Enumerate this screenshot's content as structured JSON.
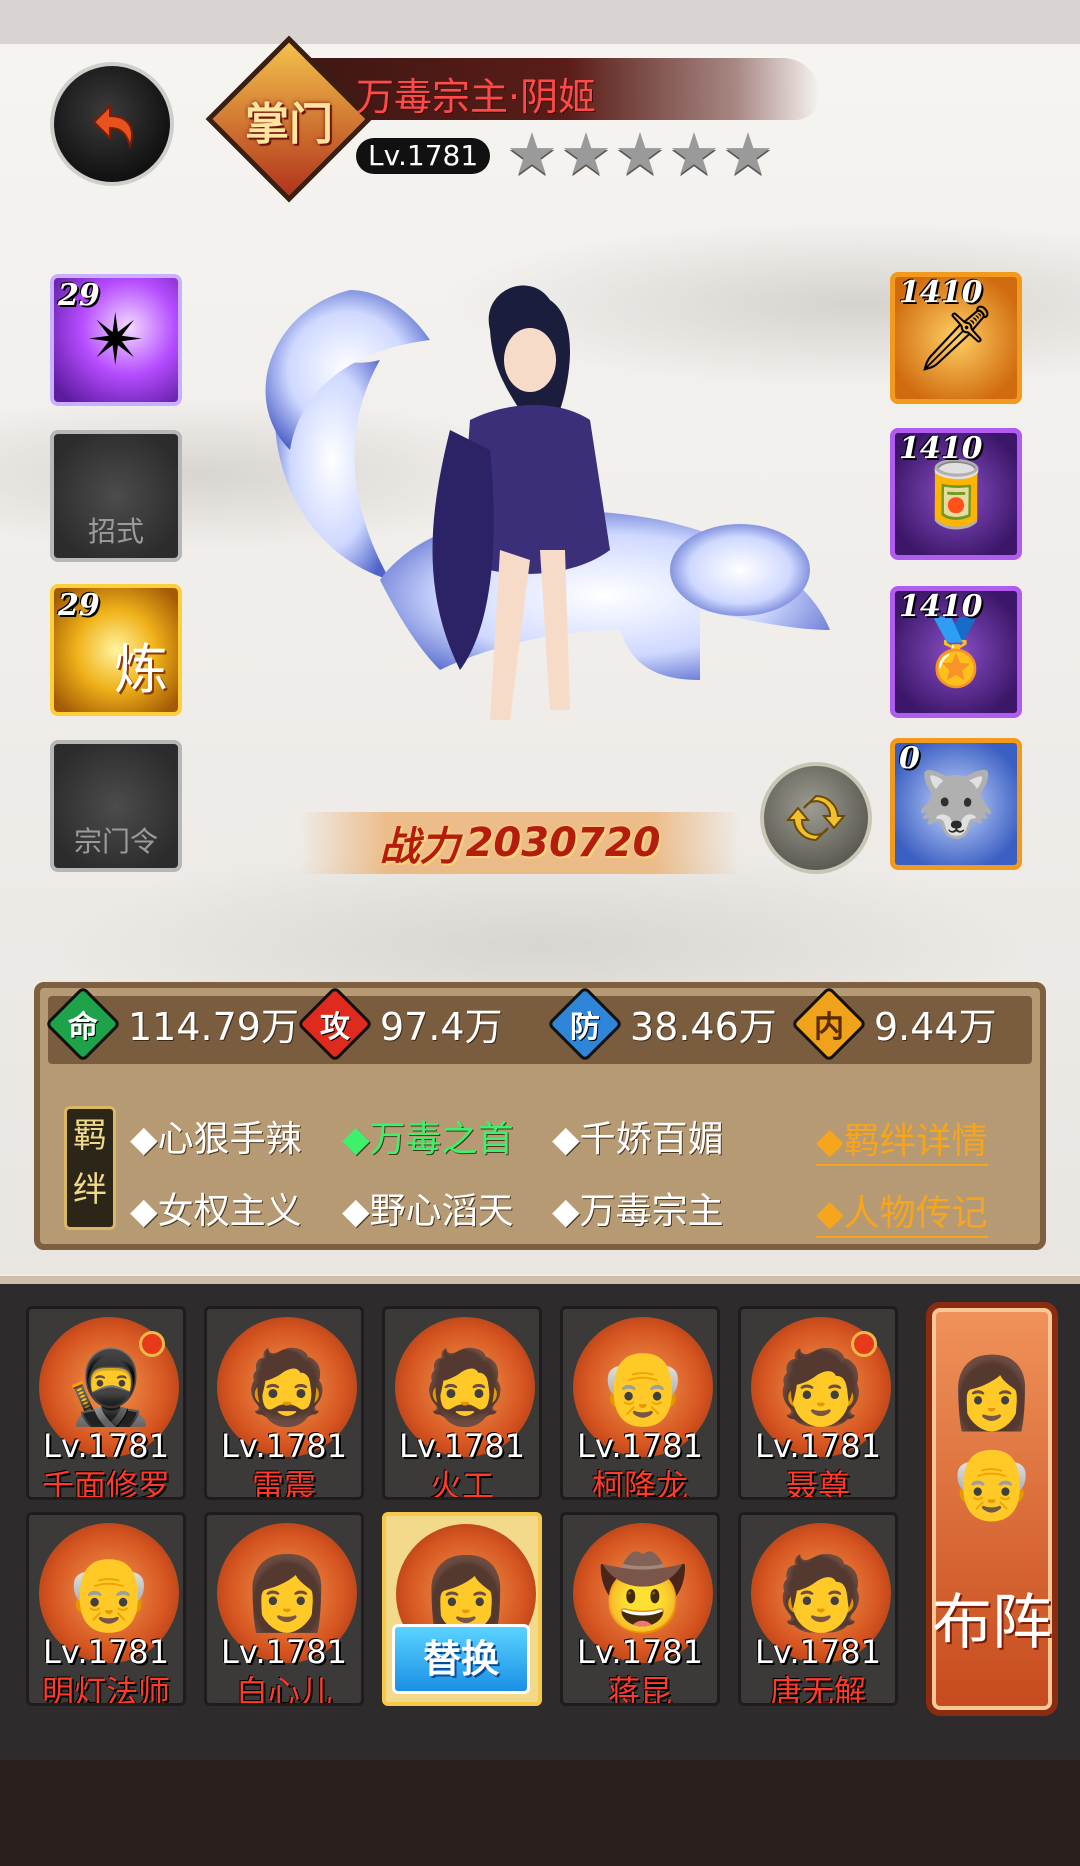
{
  "hero": {
    "rank": "掌门",
    "name": "万毒宗主·阴姬",
    "level": "Lv.1781",
    "stars": 5,
    "power_label": "战力",
    "power_value": "2030720"
  },
  "skills": [
    {
      "level": "29",
      "type": "purple",
      "icon": "shuriken-icon",
      "label": ""
    },
    {
      "level": "",
      "type": "empty",
      "icon": "",
      "label": "招式"
    },
    {
      "level": "29",
      "type": "gold",
      "icon": "refine-icon",
      "label": "炼"
    },
    {
      "level": "",
      "type": "empty",
      "icon": "",
      "label": "宗门令"
    }
  ],
  "equipment": [
    {
      "level": "1410",
      "color": "orange",
      "icon": "blade-icon"
    },
    {
      "level": "1410",
      "color": "purple",
      "icon": "bracer-icon"
    },
    {
      "level": "1410",
      "color": "purple",
      "icon": "pendant-icon"
    },
    {
      "level": "0",
      "color": "orange",
      "icon": "wolf-pet-icon"
    }
  ],
  "stats": [
    {
      "icon": "命",
      "value": "114.79万",
      "color": "#1ea34a"
    },
    {
      "icon": "攻",
      "value": "97.4万",
      "color": "#e02a1e"
    },
    {
      "icon": "防",
      "value": "38.46万",
      "color": "#2f86d9"
    },
    {
      "icon": "内",
      "value": "9.44万",
      "color": "#f0a21a"
    }
  ],
  "bonds": {
    "tag": "羁绊",
    "row1": [
      "◆心狠手辣",
      "◆万毒之首",
      "◆千娇百媚"
    ],
    "row2": [
      "◆女权主义",
      "◆野心滔天",
      "◆万毒宗主"
    ],
    "active_index": 1,
    "link1": "◆羁绊详情",
    "link2": "◆人物传记"
  },
  "roster": [
    {
      "level": "Lv.1781",
      "name": "千面修罗",
      "dot": true,
      "face": "🥷"
    },
    {
      "level": "Lv.1781",
      "name": "雷震",
      "dot": false,
      "face": "🧔"
    },
    {
      "level": "Lv.1781",
      "name": "火工",
      "dot": false,
      "face": "🧔"
    },
    {
      "level": "Lv.1781",
      "name": "柯降龙",
      "dot": false,
      "face": "👴"
    },
    {
      "level": "Lv.1781",
      "name": "聂尊",
      "dot": true,
      "face": "🧑"
    },
    {
      "level": "Lv.1781",
      "name": "明灯法师",
      "dot": false,
      "face": "👴"
    },
    {
      "level": "Lv.1781",
      "name": "白心儿",
      "dot": false,
      "face": "👩"
    },
    {
      "level": "",
      "name": "",
      "dot": false,
      "face": "👩",
      "selected": true,
      "button": "替换"
    },
    {
      "level": "Lv.1781",
      "name": "蒋昆",
      "dot": false,
      "face": "🤠"
    },
    {
      "level": "Lv.1781",
      "name": "唐无解",
      "dot": false,
      "face": "🧑"
    }
  ],
  "formation_label": "布阵"
}
